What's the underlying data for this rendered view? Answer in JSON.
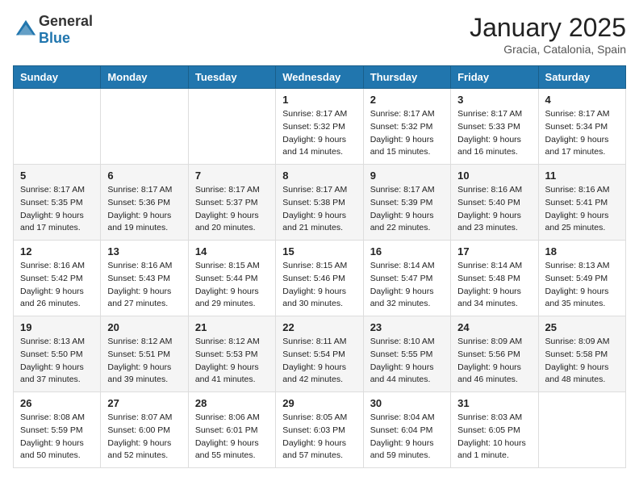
{
  "logo": {
    "general": "General",
    "blue": "Blue"
  },
  "header": {
    "month": "January 2025",
    "location": "Gracia, Catalonia, Spain"
  },
  "weekdays": [
    "Sunday",
    "Monday",
    "Tuesday",
    "Wednesday",
    "Thursday",
    "Friday",
    "Saturday"
  ],
  "weeks": [
    [
      {
        "day": "",
        "sunrise": "",
        "sunset": "",
        "daylight": ""
      },
      {
        "day": "",
        "sunrise": "",
        "sunset": "",
        "daylight": ""
      },
      {
        "day": "",
        "sunrise": "",
        "sunset": "",
        "daylight": ""
      },
      {
        "day": "1",
        "sunrise": "Sunrise: 8:17 AM",
        "sunset": "Sunset: 5:32 PM",
        "daylight": "Daylight: 9 hours and 14 minutes."
      },
      {
        "day": "2",
        "sunrise": "Sunrise: 8:17 AM",
        "sunset": "Sunset: 5:32 PM",
        "daylight": "Daylight: 9 hours and 15 minutes."
      },
      {
        "day": "3",
        "sunrise": "Sunrise: 8:17 AM",
        "sunset": "Sunset: 5:33 PM",
        "daylight": "Daylight: 9 hours and 16 minutes."
      },
      {
        "day": "4",
        "sunrise": "Sunrise: 8:17 AM",
        "sunset": "Sunset: 5:34 PM",
        "daylight": "Daylight: 9 hours and 17 minutes."
      }
    ],
    [
      {
        "day": "5",
        "sunrise": "Sunrise: 8:17 AM",
        "sunset": "Sunset: 5:35 PM",
        "daylight": "Daylight: 9 hours and 17 minutes."
      },
      {
        "day": "6",
        "sunrise": "Sunrise: 8:17 AM",
        "sunset": "Sunset: 5:36 PM",
        "daylight": "Daylight: 9 hours and 19 minutes."
      },
      {
        "day": "7",
        "sunrise": "Sunrise: 8:17 AM",
        "sunset": "Sunset: 5:37 PM",
        "daylight": "Daylight: 9 hours and 20 minutes."
      },
      {
        "day": "8",
        "sunrise": "Sunrise: 8:17 AM",
        "sunset": "Sunset: 5:38 PM",
        "daylight": "Daylight: 9 hours and 21 minutes."
      },
      {
        "day": "9",
        "sunrise": "Sunrise: 8:17 AM",
        "sunset": "Sunset: 5:39 PM",
        "daylight": "Daylight: 9 hours and 22 minutes."
      },
      {
        "day": "10",
        "sunrise": "Sunrise: 8:16 AM",
        "sunset": "Sunset: 5:40 PM",
        "daylight": "Daylight: 9 hours and 23 minutes."
      },
      {
        "day": "11",
        "sunrise": "Sunrise: 8:16 AM",
        "sunset": "Sunset: 5:41 PM",
        "daylight": "Daylight: 9 hours and 25 minutes."
      }
    ],
    [
      {
        "day": "12",
        "sunrise": "Sunrise: 8:16 AM",
        "sunset": "Sunset: 5:42 PM",
        "daylight": "Daylight: 9 hours and 26 minutes."
      },
      {
        "day": "13",
        "sunrise": "Sunrise: 8:16 AM",
        "sunset": "Sunset: 5:43 PM",
        "daylight": "Daylight: 9 hours and 27 minutes."
      },
      {
        "day": "14",
        "sunrise": "Sunrise: 8:15 AM",
        "sunset": "Sunset: 5:44 PM",
        "daylight": "Daylight: 9 hours and 29 minutes."
      },
      {
        "day": "15",
        "sunrise": "Sunrise: 8:15 AM",
        "sunset": "Sunset: 5:46 PM",
        "daylight": "Daylight: 9 hours and 30 minutes."
      },
      {
        "day": "16",
        "sunrise": "Sunrise: 8:14 AM",
        "sunset": "Sunset: 5:47 PM",
        "daylight": "Daylight: 9 hours and 32 minutes."
      },
      {
        "day": "17",
        "sunrise": "Sunrise: 8:14 AM",
        "sunset": "Sunset: 5:48 PM",
        "daylight": "Daylight: 9 hours and 34 minutes."
      },
      {
        "day": "18",
        "sunrise": "Sunrise: 8:13 AM",
        "sunset": "Sunset: 5:49 PM",
        "daylight": "Daylight: 9 hours and 35 minutes."
      }
    ],
    [
      {
        "day": "19",
        "sunrise": "Sunrise: 8:13 AM",
        "sunset": "Sunset: 5:50 PM",
        "daylight": "Daylight: 9 hours and 37 minutes."
      },
      {
        "day": "20",
        "sunrise": "Sunrise: 8:12 AM",
        "sunset": "Sunset: 5:51 PM",
        "daylight": "Daylight: 9 hours and 39 minutes."
      },
      {
        "day": "21",
        "sunrise": "Sunrise: 8:12 AM",
        "sunset": "Sunset: 5:53 PM",
        "daylight": "Daylight: 9 hours and 41 minutes."
      },
      {
        "day": "22",
        "sunrise": "Sunrise: 8:11 AM",
        "sunset": "Sunset: 5:54 PM",
        "daylight": "Daylight: 9 hours and 42 minutes."
      },
      {
        "day": "23",
        "sunrise": "Sunrise: 8:10 AM",
        "sunset": "Sunset: 5:55 PM",
        "daylight": "Daylight: 9 hours and 44 minutes."
      },
      {
        "day": "24",
        "sunrise": "Sunrise: 8:09 AM",
        "sunset": "Sunset: 5:56 PM",
        "daylight": "Daylight: 9 hours and 46 minutes."
      },
      {
        "day": "25",
        "sunrise": "Sunrise: 8:09 AM",
        "sunset": "Sunset: 5:58 PM",
        "daylight": "Daylight: 9 hours and 48 minutes."
      }
    ],
    [
      {
        "day": "26",
        "sunrise": "Sunrise: 8:08 AM",
        "sunset": "Sunset: 5:59 PM",
        "daylight": "Daylight: 9 hours and 50 minutes."
      },
      {
        "day": "27",
        "sunrise": "Sunrise: 8:07 AM",
        "sunset": "Sunset: 6:00 PM",
        "daylight": "Daylight: 9 hours and 52 minutes."
      },
      {
        "day": "28",
        "sunrise": "Sunrise: 8:06 AM",
        "sunset": "Sunset: 6:01 PM",
        "daylight": "Daylight: 9 hours and 55 minutes."
      },
      {
        "day": "29",
        "sunrise": "Sunrise: 8:05 AM",
        "sunset": "Sunset: 6:03 PM",
        "daylight": "Daylight: 9 hours and 57 minutes."
      },
      {
        "day": "30",
        "sunrise": "Sunrise: 8:04 AM",
        "sunset": "Sunset: 6:04 PM",
        "daylight": "Daylight: 9 hours and 59 minutes."
      },
      {
        "day": "31",
        "sunrise": "Sunrise: 8:03 AM",
        "sunset": "Sunset: 6:05 PM",
        "daylight": "Daylight: 10 hours and 1 minute."
      },
      {
        "day": "",
        "sunrise": "",
        "sunset": "",
        "daylight": ""
      }
    ]
  ]
}
